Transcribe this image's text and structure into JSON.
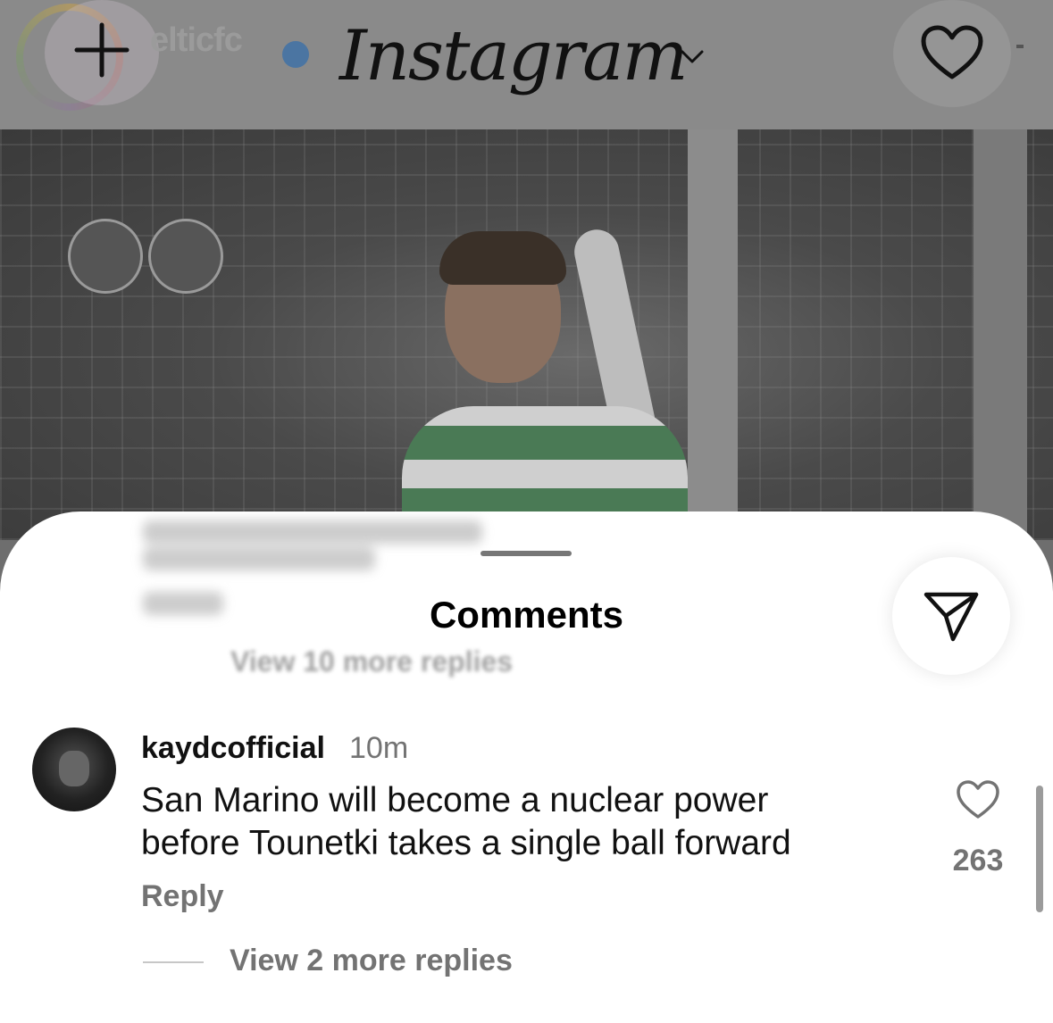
{
  "header": {
    "account_name": "elticfc",
    "logo_text": "Instagram",
    "icons": {
      "create": "plus-icon",
      "verified": "verified-badge-icon",
      "dropdown": "chevron-down-icon",
      "notifications": "heart-icon"
    }
  },
  "background_post": {
    "blurred_text": "View 10 more replies"
  },
  "comments_sheet": {
    "title": "Comments",
    "share_icon": "send-icon",
    "comment": {
      "username": "kaydcofficial",
      "time": "10m",
      "text_lines": [
        "San Marino will become a nuclear power",
        "before Tounetki takes a single ball forward"
      ],
      "reply_label": "Reply",
      "like_icon": "heart-outline-icon",
      "like_count": "263"
    },
    "view_replies_label": "View 2 more replies"
  },
  "colors": {
    "overlay": "#6e6e6e",
    "sheet_background": "#ffffff",
    "primary_text": "#111111",
    "secondary_text": "#737373"
  }
}
